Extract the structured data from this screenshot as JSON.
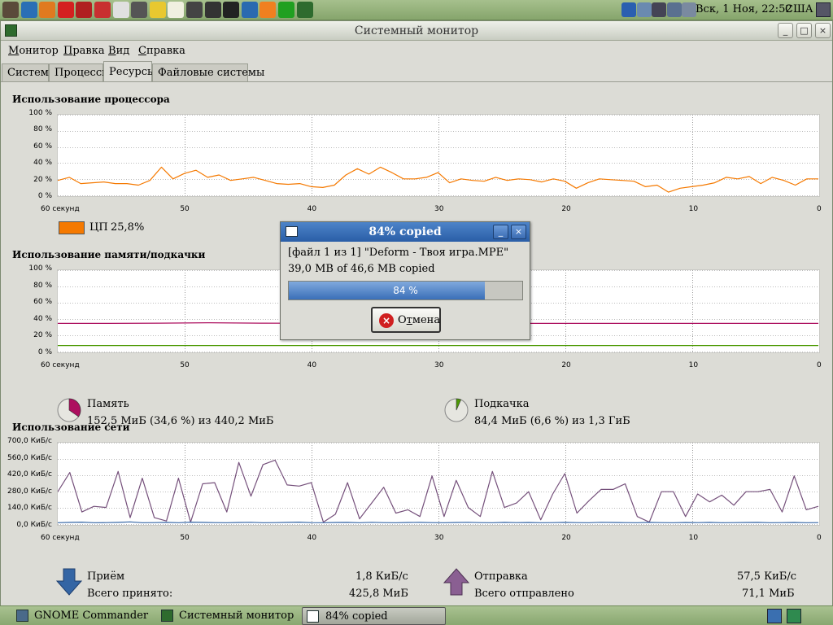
{
  "top_panel": {
    "launchers": [
      "gimp-icon",
      "browser-icon",
      "firefox-icon",
      "opera-icon",
      "gnome-commander-icon",
      "movie-player-icon",
      "file-manager-icon",
      "calculator-icon",
      "folder-icon",
      "text-editor-icon",
      "camera-icon",
      "joystick-icon",
      "terminal-icon",
      "email-icon",
      "vlc-icon",
      "media-player-icon",
      "system-monitor-icon"
    ],
    "tray": [
      "bluetooth-icon",
      "network-icon",
      "user-icon",
      "display-icon",
      "volume-icon"
    ],
    "clock": "Вск,  1 Ноя, 22:52",
    "keyboard_layout": "США"
  },
  "window": {
    "title": "Системный монитор",
    "menu": [
      {
        "accel": "М",
        "rest": "онитор"
      },
      {
        "accel": "П",
        "rest": "равка"
      },
      {
        "accel": "В",
        "rest": "ид"
      },
      {
        "accel": "С",
        "rest": "правка"
      }
    ],
    "tabs": [
      "Система",
      "Процессы",
      "Ресурсы",
      "Файловые системы"
    ],
    "active_tab": 2
  },
  "x_axis_labels": [
    "60 секунд",
    "50",
    "40",
    "30",
    "20",
    "10",
    "0"
  ],
  "cpu": {
    "title": "Использование процессора",
    "y_labels": [
      "100 %",
      "80 %",
      "60 %",
      "40 %",
      "20 %",
      "0 %"
    ],
    "legend_label": "ЦП",
    "legend_value": "25,8%",
    "color": "#f57900"
  },
  "memory": {
    "title": "Использование памяти/подкачки",
    "y_labels": [
      "100 %",
      "80 %",
      "60 %",
      "40 %",
      "20 %",
      "0 %"
    ],
    "mem_label": "Память",
    "mem_value": "152,5 МиБ (34,6 %) из 440,2 МиБ",
    "mem_color": "#ad0f5f",
    "mem_percent": 34.6,
    "swap_label": "Подкачка",
    "swap_value": "84,4 МиБ (6,6 %) из 1,3 ГиБ",
    "swap_color": "#4e9a06",
    "swap_percent": 6.6
  },
  "network": {
    "title": "Использование сети",
    "y_labels": [
      "700,0 КиБ/с",
      "560,0 КиБ/с",
      "420,0 КиБ/с",
      "280,0 КиБ/с",
      "140,0 КиБ/с",
      "0,0 КиБ/с"
    ],
    "recv_label": "Приём",
    "recv_rate": "1,8 КиБ/с",
    "recv_total_label": "Всего принято:",
    "recv_total": "425,8 МиБ",
    "recv_color": "#3465a4",
    "send_label": "Отправка",
    "send_rate": "57,5 КиБ/с",
    "send_total_label": "Всего отправлено",
    "send_total": "71,1 МиБ",
    "send_color": "#75507b"
  },
  "dialog": {
    "title": "84% copied",
    "file_line": "[файл 1 из 1] \"Deform - Твоя игра.MPE\"",
    "copied_line": "39,0 MB  of 46,6 MB  copied",
    "progress_percent": 84,
    "progress_text": "84 %",
    "cancel_accel": "т",
    "cancel_pre": "О",
    "cancel_post": "мена"
  },
  "taskbar": {
    "tasks": [
      "GNOME Commander",
      "Системный монитор",
      "84% copied"
    ],
    "active_task": 2
  },
  "chart_data": [
    {
      "type": "line",
      "title": "Использование процессора",
      "xlabel": "",
      "ylabel": "",
      "x_ticks": [
        "60 секунд",
        "50",
        "40",
        "30",
        "20",
        "10",
        "0"
      ],
      "ylim": [
        0,
        100
      ],
      "series": [
        {
          "name": "ЦП",
          "values": [
            18,
            22,
            14,
            15,
            16,
            14,
            14,
            12,
            18,
            35,
            20,
            27,
            31,
            22,
            25,
            18,
            20,
            22,
            18,
            14,
            13,
            14,
            10,
            9,
            12,
            25,
            33,
            26,
            35,
            28,
            20,
            20,
            22,
            28,
            15,
            20,
            18,
            17,
            22,
            18,
            20,
            19,
            16,
            20,
            17,
            8,
            15,
            20,
            19,
            18,
            17,
            10,
            12,
            3,
            8,
            10,
            12,
            15,
            22,
            20,
            23,
            14,
            22,
            18,
            12,
            20,
            20
          ]
        }
      ]
    },
    {
      "type": "line",
      "title": "Использование памяти/подкачки",
      "xlabel": "",
      "ylabel": "",
      "x_ticks": [
        "60 секунд",
        "50",
        "40",
        "30",
        "20",
        "10",
        "0"
      ],
      "ylim": [
        0,
        100
      ],
      "series": [
        {
          "name": "Память",
          "values": [
            34.6,
            34.6,
            35,
            35.5,
            35,
            34.8,
            34.6,
            34.6,
            34.6,
            34.6,
            34.6,
            34.6,
            34.6,
            34.6,
            34.6,
            34.6
          ]
        },
        {
          "name": "Подкачка",
          "values": [
            6.6,
            6.6,
            6.6,
            6.6,
            6.6,
            6.6,
            6.6,
            6.6,
            6.6,
            6.6,
            6.6,
            6.6,
            6.6,
            6.6,
            6.6,
            6.6
          ]
        }
      ]
    },
    {
      "type": "line",
      "title": "Использование сети",
      "xlabel": "",
      "ylabel": "",
      "x_ticks": [
        "60 секунд",
        "50",
        "40",
        "30",
        "20",
        "10",
        "0"
      ],
      "ylim": [
        0,
        700
      ],
      "series": [
        {
          "name": "Отправка",
          "values": [
            280,
            450,
            100,
            150,
            140,
            460,
            50,
            400,
            50,
            20,
            400,
            10,
            350,
            360,
            100,
            540,
            240,
            520,
            560,
            340,
            330,
            360,
            10,
            80,
            360,
            40,
            180,
            320,
            90,
            120,
            60,
            420,
            60,
            380,
            140,
            60,
            460,
            140,
            180,
            280,
            30,
            260,
            440,
            90,
            200,
            300,
            300,
            350,
            60,
            10,
            280,
            280,
            60,
            260,
            190,
            250,
            160,
            280,
            280,
            300,
            100,
            420,
            120,
            150
          ]
        },
        {
          "name": "Приём",
          "values": [
            5,
            8,
            10,
            5,
            6,
            8,
            12,
            5,
            6,
            8,
            5,
            10,
            8,
            6,
            5,
            7,
            9,
            5,
            6,
            8,
            10,
            6,
            5,
            7,
            8,
            5,
            9,
            6,
            5,
            7,
            8,
            6,
            5,
            7,
            9,
            6,
            5,
            8,
            6,
            7,
            5,
            6,
            8,
            6,
            5,
            9,
            7,
            6,
            5,
            8,
            6,
            5,
            7,
            6,
            8,
            5,
            6,
            7,
            8,
            5,
            6,
            7,
            5,
            6
          ]
        }
      ]
    }
  ]
}
